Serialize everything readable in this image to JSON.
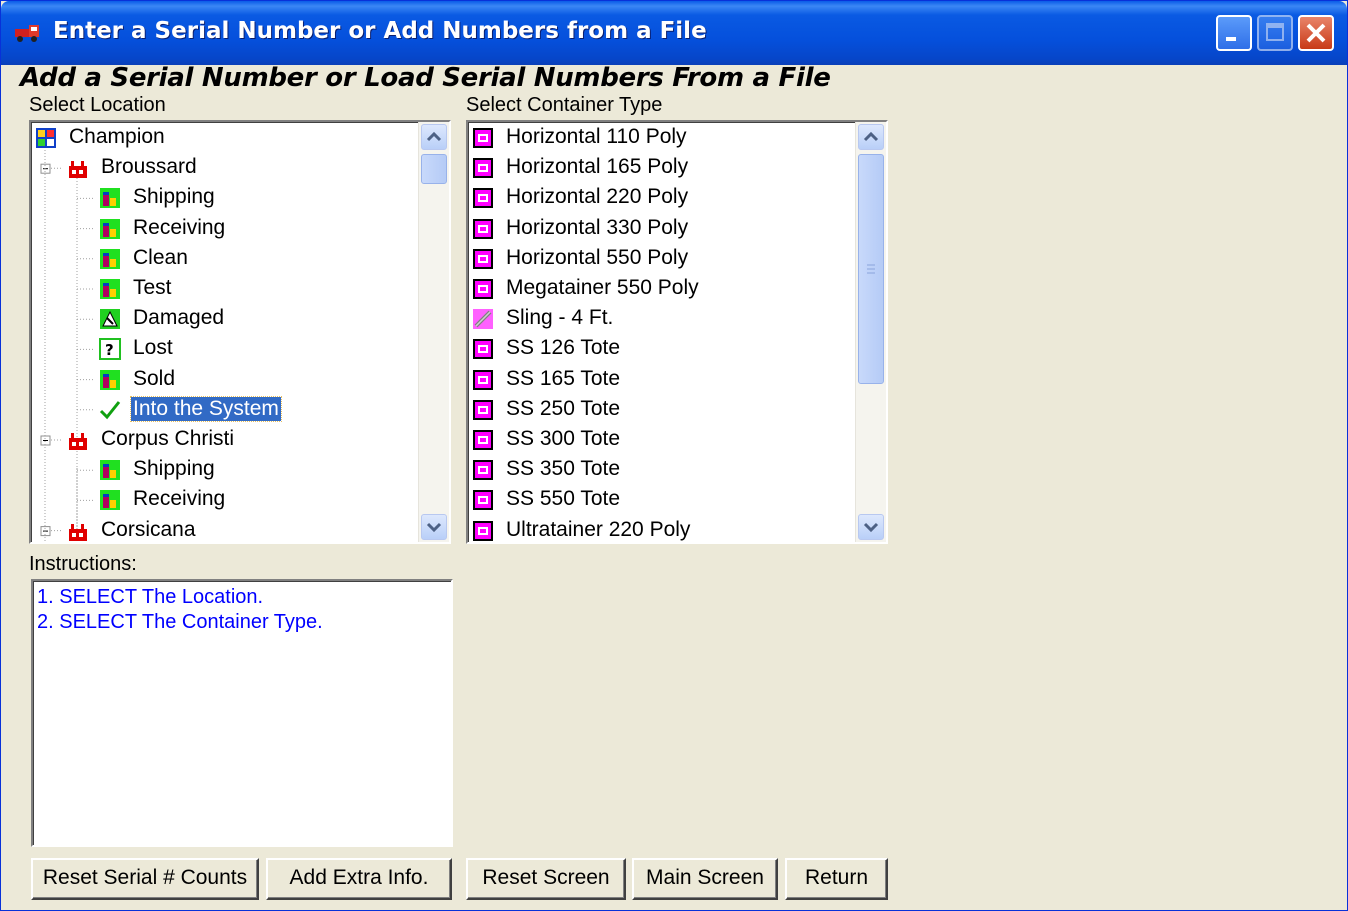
{
  "window": {
    "title": "Enter a Serial Number or Add Numbers from a File",
    "buttons": {
      "minimize": "minimize",
      "maximize": "maximize",
      "close": "close"
    }
  },
  "heading": "Add a Serial Number or Load Serial Numbers From a File",
  "location_label": "Select Location",
  "container_label": "Select Container Type",
  "location_tree": [
    {
      "label": "Champion",
      "icon": "champion-icon",
      "level": 0
    },
    {
      "label": "Broussard",
      "icon": "plant-icon",
      "level": 1
    },
    {
      "label": "Shipping",
      "icon": "bin-icon",
      "level": 2
    },
    {
      "label": "Receiving",
      "icon": "bin-icon",
      "level": 2
    },
    {
      "label": "Clean",
      "icon": "bin-icon",
      "level": 2
    },
    {
      "label": "Test",
      "icon": "bin-icon",
      "level": 2
    },
    {
      "label": "Damaged",
      "icon": "damaged-icon",
      "level": 2
    },
    {
      "label": "Lost",
      "icon": "question-icon",
      "level": 2
    },
    {
      "label": "Sold",
      "icon": "bin-icon",
      "level": 2
    },
    {
      "label": "Into the System",
      "icon": "checkmark-icon",
      "level": 2,
      "selected": true
    },
    {
      "label": "Corpus Christi",
      "icon": "plant-icon",
      "level": 1
    },
    {
      "label": "Shipping",
      "icon": "bin-icon",
      "level": 2
    },
    {
      "label": "Receiving",
      "icon": "bin-icon",
      "level": 2
    },
    {
      "label": "Corsicana",
      "icon": "plant-icon",
      "level": 1
    }
  ],
  "container_types": [
    {
      "label": "Horizontal 110 Poly",
      "icon": "tote-icon"
    },
    {
      "label": "Horizontal 165 Poly",
      "icon": "tote-icon"
    },
    {
      "label": "Horizontal 220 Poly",
      "icon": "tote-icon"
    },
    {
      "label": "Horizontal 330 Poly",
      "icon": "tote-icon"
    },
    {
      "label": "Horizontal 550 Poly",
      "icon": "tote-icon"
    },
    {
      "label": "Megatainer 550 Poly",
      "icon": "tote-icon"
    },
    {
      "label": "Sling - 4 Ft.",
      "icon": "sling-icon"
    },
    {
      "label": "SS 126 Tote",
      "icon": "tote-icon"
    },
    {
      "label": "SS 165 Tote",
      "icon": "tote-icon"
    },
    {
      "label": "SS 250 Tote",
      "icon": "tote-icon"
    },
    {
      "label": "SS 300 Tote",
      "icon": "tote-icon"
    },
    {
      "label": "SS 350 Tote",
      "icon": "tote-icon"
    },
    {
      "label": "SS 550 Tote",
      "icon": "tote-icon"
    },
    {
      "label": "Ultratainer 220 Poly",
      "icon": "tote-icon"
    }
  ],
  "instructions_label": "Instructions:",
  "instructions": [
    "1.  SELECT The Location.",
    "2.  SELECT The Container Type."
  ],
  "buttons": {
    "reset_counts": "Reset Serial # Counts",
    "add_extra": "Add Extra Info.",
    "reset_screen": "Reset Screen",
    "main_screen": "Main Screen",
    "return": "Return"
  },
  "colors": {
    "titlebar": "#0550dc",
    "window_bg": "#ece9d8",
    "selection": "#316ac5",
    "instruction_text": "#0000ff",
    "tote_icon": "#ff00ff"
  }
}
